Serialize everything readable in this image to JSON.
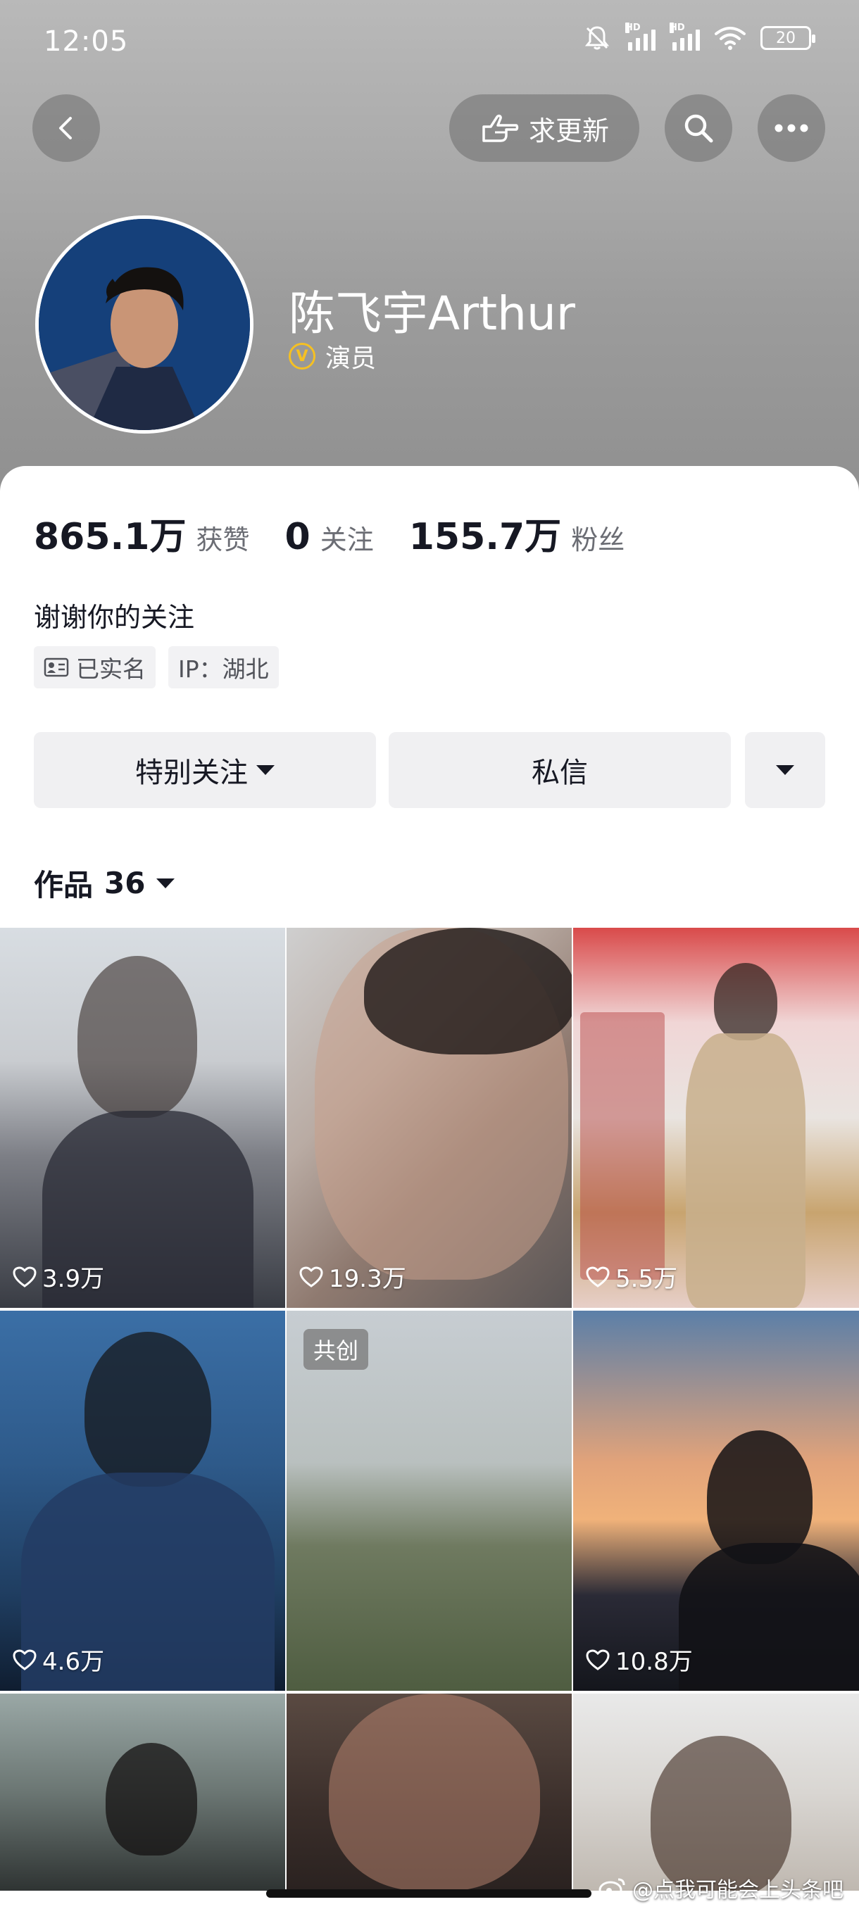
{
  "status_bar": {
    "time": "12:05",
    "signal1": "HD",
    "signal2": "HD",
    "battery": "20"
  },
  "toolbar": {
    "request_update_label": "求更新",
    "back_icon": "chevron-left-icon",
    "search_icon": "search-icon",
    "more_icon": "more-dots-icon"
  },
  "profile": {
    "name": "陈飞宇Arthur",
    "verified_badge": "V",
    "role": "演员",
    "bio": "谢谢你的关注"
  },
  "stats": [
    {
      "value": "865.1万",
      "label": "获赞"
    },
    {
      "value": "0",
      "label": "关注"
    },
    {
      "value": "155.7万",
      "label": "粉丝"
    }
  ],
  "tags": {
    "verified_name": "已实名",
    "ip": "IP：湖北"
  },
  "actions": {
    "follow_label": "特别关注",
    "message_label": "私信"
  },
  "works": {
    "label": "作品",
    "count": "36"
  },
  "videos": [
    {
      "likes": "3.9万"
    },
    {
      "likes": "19.3万"
    },
    {
      "likes": "5.5万"
    },
    {
      "likes": "4.6万"
    },
    {
      "likes": "",
      "badge": "共创"
    },
    {
      "likes": "10.8万"
    },
    {
      "likes": ""
    },
    {
      "likes": ""
    },
    {
      "likes": ""
    }
  ],
  "watermark": "@点我可能会上头条吧",
  "colors": {
    "verified_gold": "#f5c022",
    "button_bg": "#f0f0f2",
    "text_primary": "#161823",
    "text_secondary": "#6b6d74"
  }
}
